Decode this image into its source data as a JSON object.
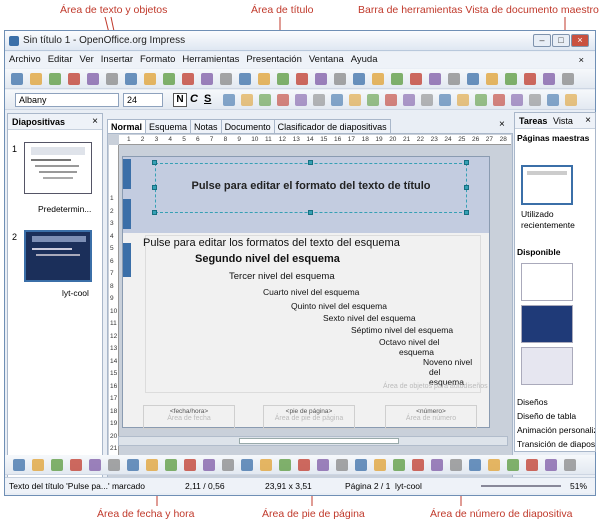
{
  "annotations": {
    "top_left": "Área de texto y objetos",
    "top_mid": "Área de título",
    "top_right": "Barra de herramientas Vista de documento maestro",
    "bot_left": "Área de fecha y hora",
    "bot_mid": "Área de pie de página",
    "bot_right": "Área de número de diapositiva"
  },
  "window": {
    "title": "Sin título 1 - OpenOffice.org Impress"
  },
  "menu": [
    "Archivo",
    "Editar",
    "Ver",
    "Insertar",
    "Formato",
    "Herramientas",
    "Presentación",
    "Ventana",
    "Ayuda"
  ],
  "format_bar": {
    "font": "Albany",
    "size": "24"
  },
  "slides_panel": {
    "title": "Diapositivas",
    "slides": [
      {
        "num": "1",
        "label": "Predetermin..."
      },
      {
        "num": "2",
        "label": "lyt-cool"
      }
    ]
  },
  "view_tabs": [
    "Normal",
    "Esquema",
    "Notas",
    "Documento",
    "Clasificador de diapositivas"
  ],
  "slide": {
    "title": "Pulse para editar el formato del texto de título",
    "levels": [
      "Pulse para editar los formatos del texto del esquema",
      "Segundo nivel del esquema",
      "Tercer nivel del esquema",
      "Cuarto nivel del esquema",
      "Quinto nivel del esquema",
      "Sexto nivel del esquema",
      "Séptimo nivel del esquema",
      "Octavo nivel del",
      "esquema",
      "Noveno nivel",
      "del",
      "esquema"
    ],
    "ghost_obj": "Área de objetos para autodiseños",
    "footer": {
      "date_field": "<fecha/hora>",
      "date_ghost": "Área de fecha",
      "footer_field": "<pie de página>",
      "footer_ghost": "Área de pie de página",
      "num_field": "<número>",
      "num_ghost": "Área de número"
    }
  },
  "tasks": {
    "title": "Tareas",
    "view": "Vista",
    "section": "Páginas maestras",
    "recent": "Utilizado recientemente",
    "available": "Disponible",
    "items": [
      "Diseños",
      "Diseño de tabla",
      "Animación personalizada",
      "Transición de diapositivas"
    ]
  },
  "ruler_v": [
    "1",
    "2",
    "3",
    "4",
    "5",
    "6",
    "7",
    "8",
    "9",
    "10",
    "11",
    "12",
    "13",
    "14",
    "15",
    "16",
    "17",
    "18",
    "19",
    "20",
    "21"
  ],
  "ruler_h": [
    "1",
    "2",
    "3",
    "4",
    "5",
    "6",
    "7",
    "8",
    "9",
    "10",
    "11",
    "12",
    "13",
    "14",
    "15",
    "16",
    "17",
    "18",
    "19",
    "20",
    "21",
    "22",
    "23",
    "24",
    "25",
    "26",
    "27",
    "28"
  ],
  "status": {
    "text": "Texto del título 'Pulse pa...' marcado",
    "pos": "2,11 / 0,56",
    "size": "23,91 x 3,51",
    "page": "Página 2 / 1",
    "master": "lyt-cool",
    "zoom": "51%"
  },
  "colors": {
    "accent": "#3b6fa8",
    "slide_bg": "#f1f1f1",
    "title_band": "#c3cce0"
  }
}
